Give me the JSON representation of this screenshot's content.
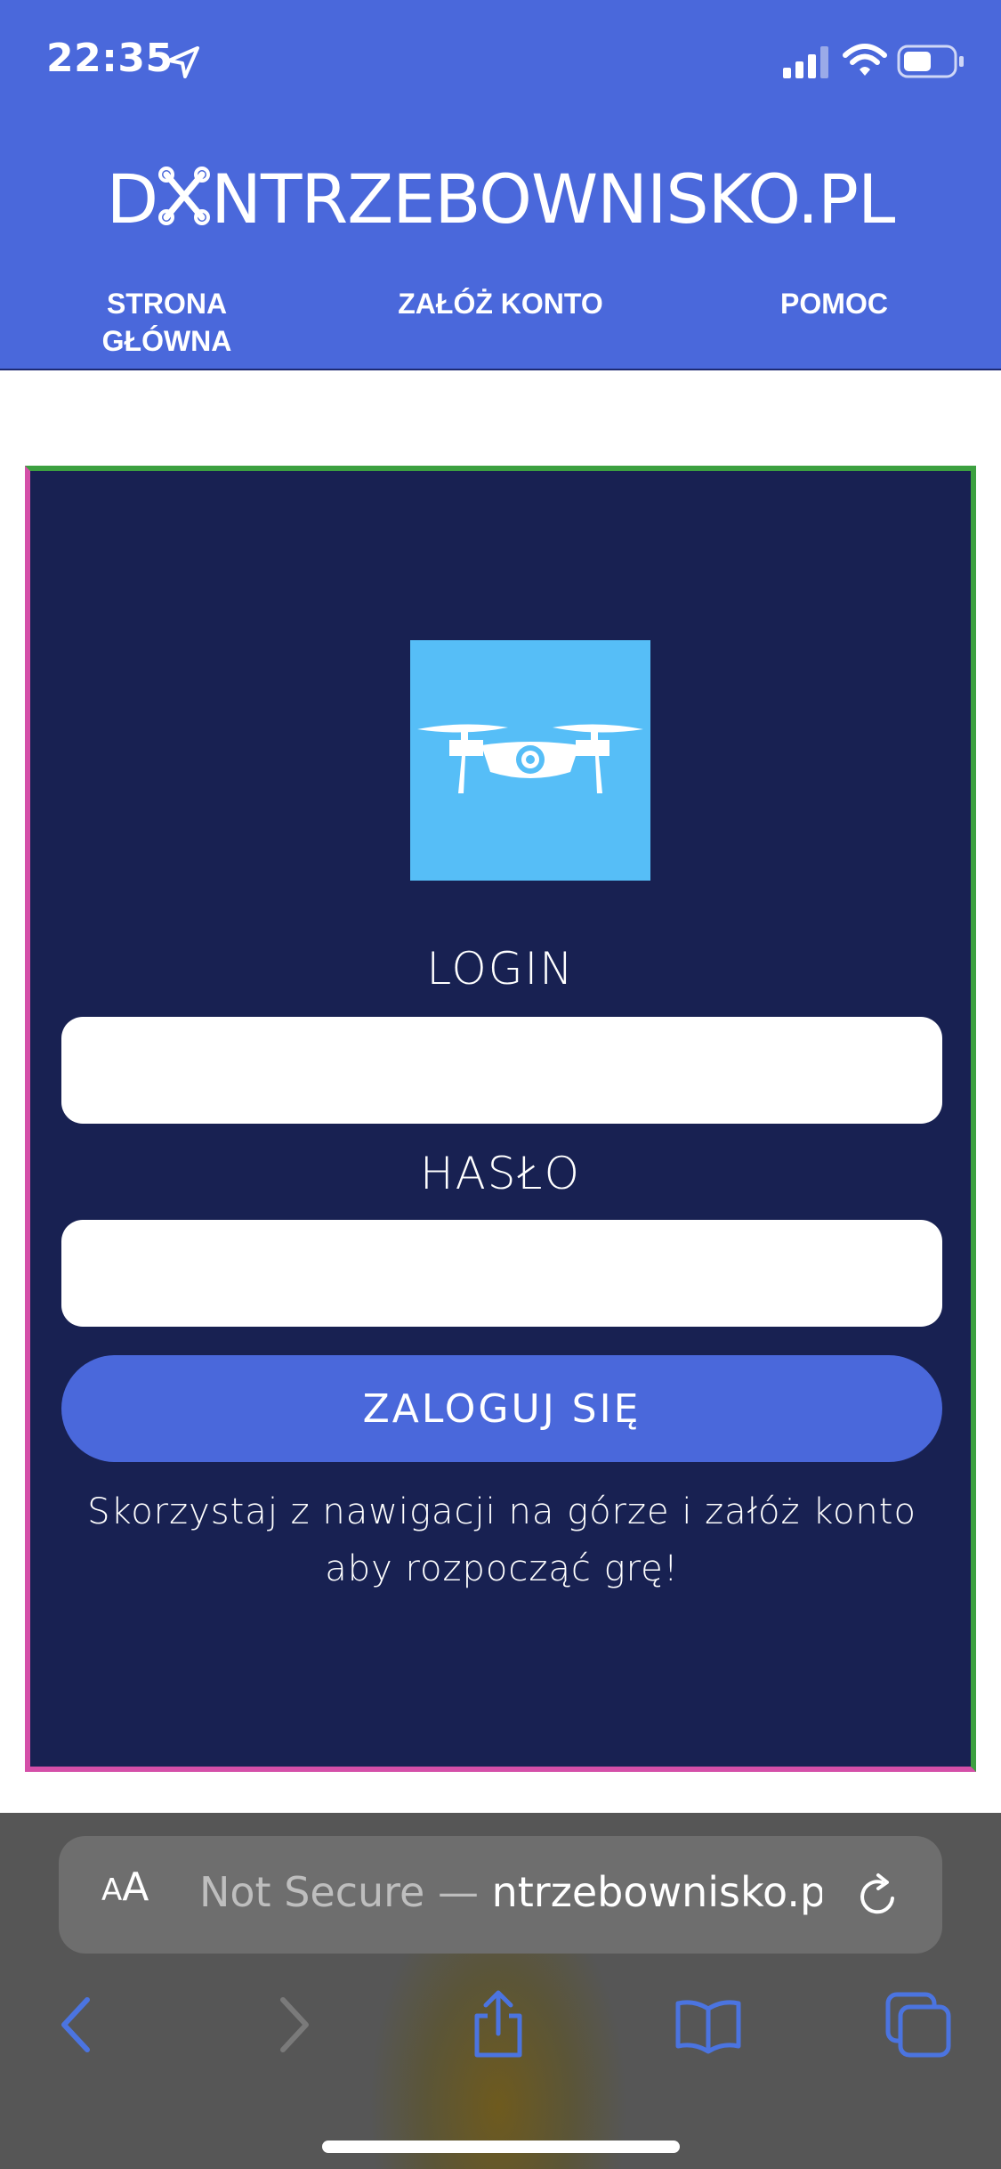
{
  "status_bar": {
    "time": "22:35",
    "icons": [
      "location-arrow-icon",
      "cellular-signal-icon",
      "wifi-icon",
      "battery-icon"
    ]
  },
  "header": {
    "logo_prefix": "D",
    "logo_suffix": "NTRZEBOWNISKO.PL",
    "background_color": "#4A68DB",
    "nav": {
      "home_line1": "STRONA",
      "home_line2": "GŁÓWNA",
      "register": "ZAŁÓŻ KONTO",
      "help": "POMOC"
    }
  },
  "login_form": {
    "background_color": "#182152",
    "logo_tile_color": "#56BEF7",
    "login_label": "LOGIN",
    "login_value": "",
    "password_label": "HASŁO",
    "password_value": "",
    "submit_label": "ZALOGUJ SIĘ",
    "hint": "Skorzystaj z nawigacji na górze i załóż konto aby rozpocząć grę!"
  },
  "browser": {
    "aa_label_small": "A",
    "aa_label_big": "A",
    "url_security": "Not Secure — ",
    "url_host": "ntrzebownisko.pl",
    "toolbar": [
      "back-icon",
      "forward-icon",
      "share-icon",
      "bookmarks-icon",
      "tabs-icon"
    ]
  }
}
